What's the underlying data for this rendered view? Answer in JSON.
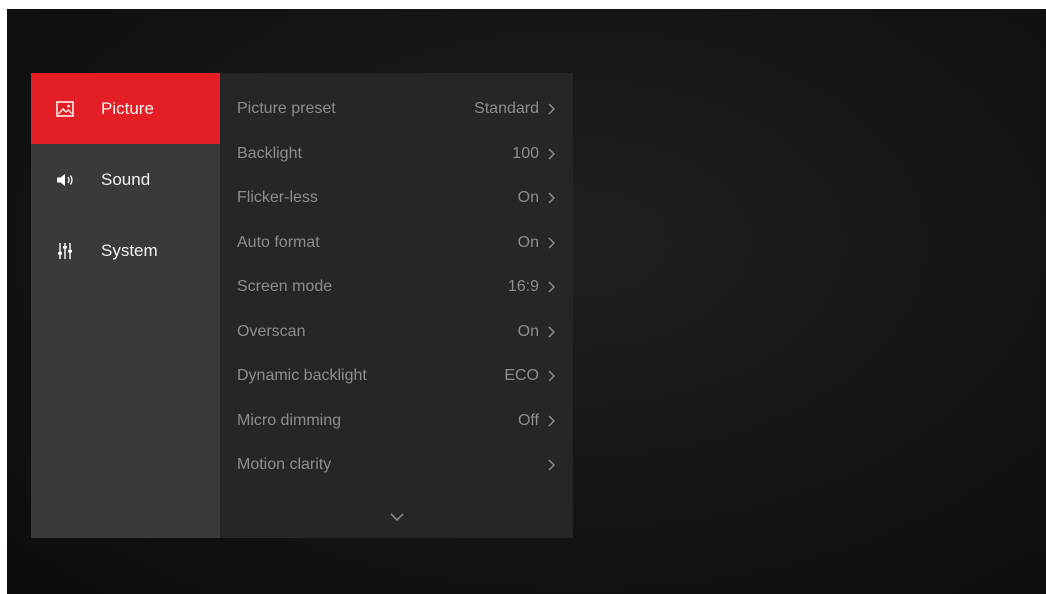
{
  "sidebar": {
    "items": [
      {
        "label": "Picture",
        "icon": "picture-icon",
        "active": true
      },
      {
        "label": "Sound",
        "icon": "speaker-icon",
        "active": false
      },
      {
        "label": "System",
        "icon": "sliders-icon",
        "active": false
      }
    ]
  },
  "settings": {
    "rows": [
      {
        "label": "Picture preset",
        "value": "Standard"
      },
      {
        "label": "Backlight",
        "value": "100"
      },
      {
        "label": "Flicker-less",
        "value": "On"
      },
      {
        "label": "Auto format",
        "value": "On"
      },
      {
        "label": "Screen mode",
        "value": "16:9"
      },
      {
        "label": "Overscan",
        "value": "On"
      },
      {
        "label": "Dynamic backlight",
        "value": "ECO"
      },
      {
        "label": "Micro dimming",
        "value": "Off"
      },
      {
        "label": "Motion clarity",
        "value": ""
      }
    ]
  },
  "colors": {
    "accent": "#e31e24",
    "sidebar_bg": "#3a3a3c",
    "list_bg": "#262628",
    "screen_bg": "#141414"
  }
}
